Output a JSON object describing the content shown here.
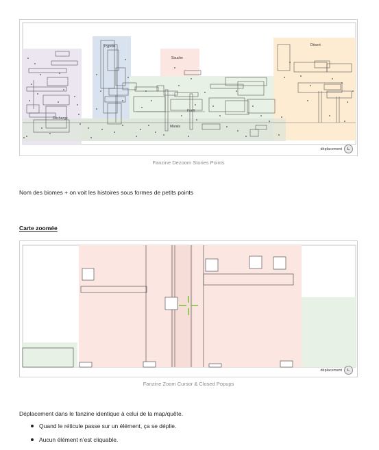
{
  "figure1": {
    "caption": "Fanzine Dezoom Stories Points",
    "badge_label": "déplacement",
    "badge_key": "L",
    "biomes": {
      "decharge": "Décharge",
      "trypolis": "Trypolis",
      "souche": "Souche",
      "foret": "Forêt",
      "marais": "Marais",
      "desert": "Désert"
    }
  },
  "paragraph1": "Nom des biomes + on voit les histoires sous formes de petits points",
  "heading_zoomed": "Carte zoomée",
  "figure2": {
    "caption": "Fanzine Zoom Cursor & Closed Popups",
    "badge_label": "déplacement",
    "badge_key": "L"
  },
  "paragraph2": "Déplacement dans le fanzine identique à celui de la map/quête.",
  "bullets": [
    "Quand le réticule passe sur un élément, ça se déplie.",
    "Aucun élément n’est cliquable."
  ],
  "colors": {
    "purple": "#ece6f1",
    "blue": "#d9e2ef",
    "pink": "#fbe6e1",
    "green": "#e8f1e6",
    "orange": "#fdebd2",
    "reticle": "#7cc242"
  }
}
